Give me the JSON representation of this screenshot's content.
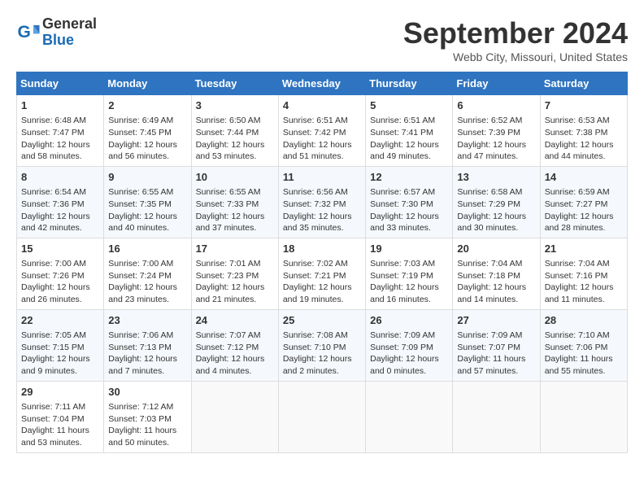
{
  "header": {
    "logo_line1": "General",
    "logo_line2": "Blue",
    "month_title": "September 2024",
    "location": "Webb City, Missouri, United States"
  },
  "weekdays": [
    "Sunday",
    "Monday",
    "Tuesday",
    "Wednesday",
    "Thursday",
    "Friday",
    "Saturday"
  ],
  "weeks": [
    [
      {
        "day": "1",
        "sunrise": "6:48 AM",
        "sunset": "7:47 PM",
        "daylight": "12 hours and 58 minutes."
      },
      {
        "day": "2",
        "sunrise": "6:49 AM",
        "sunset": "7:45 PM",
        "daylight": "12 hours and 56 minutes."
      },
      {
        "day": "3",
        "sunrise": "6:50 AM",
        "sunset": "7:44 PM",
        "daylight": "12 hours and 53 minutes."
      },
      {
        "day": "4",
        "sunrise": "6:51 AM",
        "sunset": "7:42 PM",
        "daylight": "12 hours and 51 minutes."
      },
      {
        "day": "5",
        "sunrise": "6:51 AM",
        "sunset": "7:41 PM",
        "daylight": "12 hours and 49 minutes."
      },
      {
        "day": "6",
        "sunrise": "6:52 AM",
        "sunset": "7:39 PM",
        "daylight": "12 hours and 47 minutes."
      },
      {
        "day": "7",
        "sunrise": "6:53 AM",
        "sunset": "7:38 PM",
        "daylight": "12 hours and 44 minutes."
      }
    ],
    [
      {
        "day": "8",
        "sunrise": "6:54 AM",
        "sunset": "7:36 PM",
        "daylight": "12 hours and 42 minutes."
      },
      {
        "day": "9",
        "sunrise": "6:55 AM",
        "sunset": "7:35 PM",
        "daylight": "12 hours and 40 minutes."
      },
      {
        "day": "10",
        "sunrise": "6:55 AM",
        "sunset": "7:33 PM",
        "daylight": "12 hours and 37 minutes."
      },
      {
        "day": "11",
        "sunrise": "6:56 AM",
        "sunset": "7:32 PM",
        "daylight": "12 hours and 35 minutes."
      },
      {
        "day": "12",
        "sunrise": "6:57 AM",
        "sunset": "7:30 PM",
        "daylight": "12 hours and 33 minutes."
      },
      {
        "day": "13",
        "sunrise": "6:58 AM",
        "sunset": "7:29 PM",
        "daylight": "12 hours and 30 minutes."
      },
      {
        "day": "14",
        "sunrise": "6:59 AM",
        "sunset": "7:27 PM",
        "daylight": "12 hours and 28 minutes."
      }
    ],
    [
      {
        "day": "15",
        "sunrise": "7:00 AM",
        "sunset": "7:26 PM",
        "daylight": "12 hours and 26 minutes."
      },
      {
        "day": "16",
        "sunrise": "7:00 AM",
        "sunset": "7:24 PM",
        "daylight": "12 hours and 23 minutes."
      },
      {
        "day": "17",
        "sunrise": "7:01 AM",
        "sunset": "7:23 PM",
        "daylight": "12 hours and 21 minutes."
      },
      {
        "day": "18",
        "sunrise": "7:02 AM",
        "sunset": "7:21 PM",
        "daylight": "12 hours and 19 minutes."
      },
      {
        "day": "19",
        "sunrise": "7:03 AM",
        "sunset": "7:19 PM",
        "daylight": "12 hours and 16 minutes."
      },
      {
        "day": "20",
        "sunrise": "7:04 AM",
        "sunset": "7:18 PM",
        "daylight": "12 hours and 14 minutes."
      },
      {
        "day": "21",
        "sunrise": "7:04 AM",
        "sunset": "7:16 PM",
        "daylight": "12 hours and 11 minutes."
      }
    ],
    [
      {
        "day": "22",
        "sunrise": "7:05 AM",
        "sunset": "7:15 PM",
        "daylight": "12 hours and 9 minutes."
      },
      {
        "day": "23",
        "sunrise": "7:06 AM",
        "sunset": "7:13 PM",
        "daylight": "12 hours and 7 minutes."
      },
      {
        "day": "24",
        "sunrise": "7:07 AM",
        "sunset": "7:12 PM",
        "daylight": "12 hours and 4 minutes."
      },
      {
        "day": "25",
        "sunrise": "7:08 AM",
        "sunset": "7:10 PM",
        "daylight": "12 hours and 2 minutes."
      },
      {
        "day": "26",
        "sunrise": "7:09 AM",
        "sunset": "7:09 PM",
        "daylight": "12 hours and 0 minutes."
      },
      {
        "day": "27",
        "sunrise": "7:09 AM",
        "sunset": "7:07 PM",
        "daylight": "11 hours and 57 minutes."
      },
      {
        "day": "28",
        "sunrise": "7:10 AM",
        "sunset": "7:06 PM",
        "daylight": "11 hours and 55 minutes."
      }
    ],
    [
      {
        "day": "29",
        "sunrise": "7:11 AM",
        "sunset": "7:04 PM",
        "daylight": "11 hours and 53 minutes."
      },
      {
        "day": "30",
        "sunrise": "7:12 AM",
        "sunset": "7:03 PM",
        "daylight": "11 hours and 50 minutes."
      },
      null,
      null,
      null,
      null,
      null
    ]
  ]
}
